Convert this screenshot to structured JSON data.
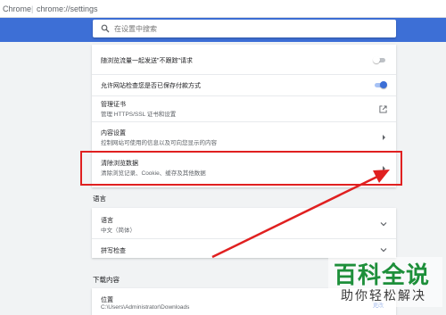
{
  "browser": {
    "host_label": "Chrome",
    "separator": "|",
    "url": "chrome://settings"
  },
  "search": {
    "placeholder": "在设置中搜索",
    "icon": "search-icon"
  },
  "privacy_rows": [
    {
      "title": "随浏览流量一起发送\"不跟踪\"请求",
      "control": "toggle",
      "state": "off"
    },
    {
      "title": "允许网站检查您是否已保存付款方式",
      "control": "toggle",
      "state": "on"
    },
    {
      "title": "管理证书",
      "subtitle": "管理 HTTPS/SSL 证书和设置",
      "control": "external-link-icon"
    },
    {
      "title": "内容设置",
      "subtitle": "控制网站可使用的信息以及可向您显示的内容",
      "control": "arrow-right-icon"
    },
    {
      "title": "清除浏览数据",
      "subtitle": "清除浏览记录、Cookie、缓存及其他数据",
      "control": "arrow-right-icon"
    }
  ],
  "language_section": {
    "title": "语言",
    "rows": [
      {
        "title": "语言",
        "subtitle": "中文（简体）",
        "control": "chevron-down-icon"
      },
      {
        "title": "拼写检查",
        "control": "chevron-down-icon"
      }
    ]
  },
  "download_section": {
    "title": "下载内容",
    "location_title": "位置",
    "location_path": "C:\\Users\\Administrator\\Downloads",
    "change_label": "更改"
  },
  "annotation": {
    "highlight_color": "#e02020",
    "target": "清除浏览数据"
  },
  "watermark": {
    "main": "百科全说",
    "sub": "助你轻松解决",
    "color": "#1d8f3a"
  },
  "colors": {
    "header_blue": "#3d6fd6",
    "background": "#f1f3f4"
  }
}
